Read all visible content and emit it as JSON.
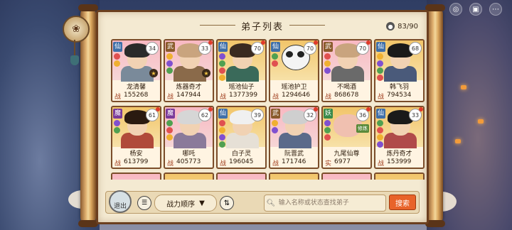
{
  "panel": {
    "title": "弟子列表",
    "count": "83/90"
  },
  "cards": [
    {
      "level": "34",
      "name": "龙清馨",
      "label": "战",
      "power": "155268",
      "faction": "仙",
      "bg": "pink"
    },
    {
      "level": "33",
      "name": "炼器奇才",
      "label": "战",
      "power": "147944",
      "faction": "武",
      "bg": "pink"
    },
    {
      "level": "70",
      "name": "瑶池仙子",
      "label": "战",
      "power": "1377399",
      "faction": "仙",
      "bg": "gold"
    },
    {
      "level": "70",
      "name": "瑶池护卫",
      "label": "战",
      "power": "1294646",
      "faction": "仙",
      "bg": "gold"
    },
    {
      "level": "70",
      "name": "不喝酒",
      "label": "战",
      "power": "868678",
      "faction": "武",
      "bg": "pink"
    },
    {
      "level": "68",
      "name": "韩飞羽",
      "label": "战",
      "power": "794534",
      "faction": "仙",
      "bg": "gold"
    },
    {
      "level": "61",
      "name": "杨安",
      "label": "战",
      "power": "613799",
      "faction": "魔",
      "bg": "gold"
    },
    {
      "level": "62",
      "name": "哪吒",
      "label": "战",
      "power": "405773",
      "faction": "魔",
      "bg": "pink"
    },
    {
      "level": "39",
      "name": "白子灵",
      "label": "战",
      "power": "196045",
      "faction": "仙",
      "bg": "gold"
    },
    {
      "level": "32",
      "name": "阮晋武",
      "label": "战",
      "power": "171746",
      "faction": "武",
      "bg": "pink"
    },
    {
      "level": "36",
      "name": "九尾仙尊",
      "label": "实",
      "power": "6977",
      "faction": "妖",
      "bg": "gold",
      "chip": "修炼"
    },
    {
      "level": "33",
      "name": "炼丹奇才",
      "label": "战",
      "power": "153999",
      "faction": "仙",
      "bg": "gold"
    }
  ],
  "toolbar": {
    "exit_label": "退出",
    "sort_label": "战力顺序",
    "search_placeholder": "输入名称或状态查找弟子",
    "search_button": "搜索"
  },
  "icons": {
    "counter": "person-circle-icon",
    "list": "list-icon",
    "swap": "swap-arrows-icon",
    "search": "search-icon"
  }
}
